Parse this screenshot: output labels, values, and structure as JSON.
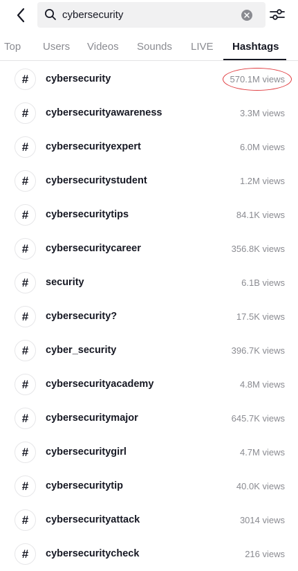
{
  "search": {
    "query": "cybersecurity",
    "back_icon": "chevron-left-icon",
    "search_icon": "magnifier-icon",
    "clear_icon": "clear-x-icon",
    "filter_icon": "sliders-icon"
  },
  "tabs": [
    {
      "label": "Top",
      "active": false
    },
    {
      "label": "Users",
      "active": false
    },
    {
      "label": "Videos",
      "active": false
    },
    {
      "label": "Sounds",
      "active": false
    },
    {
      "label": "LIVE",
      "active": false
    },
    {
      "label": "Hashtags",
      "active": true
    }
  ],
  "hashtag_symbol": "#",
  "hashtags": [
    {
      "name": "cybersecurity",
      "views": "570.1M views",
      "highlighted": true
    },
    {
      "name": "cybersecurityawareness",
      "views": "3.3M views"
    },
    {
      "name": "cybersecurityexpert",
      "views": "6.0M views"
    },
    {
      "name": "cybersecuritystudent",
      "views": "1.2M views"
    },
    {
      "name": "cybersecuritytips",
      "views": "84.1K views"
    },
    {
      "name": "cybersecuritycareer",
      "views": "356.8K views"
    },
    {
      "name": "security",
      "views": "6.1B views"
    },
    {
      "name": "cybersecurity?",
      "views": "17.5K views"
    },
    {
      "name": "cyber_security",
      "views": "396.7K views"
    },
    {
      "name": "cybersecurityacademy",
      "views": "4.8M views"
    },
    {
      "name": "cybersecuritymajor",
      "views": "645.7K views"
    },
    {
      "name": "cybersecuritygirl",
      "views": "4.7M views"
    },
    {
      "name": "cybersecuritytip",
      "views": "40.0K views"
    },
    {
      "name": "cybersecurityattack",
      "views": "3014 views"
    },
    {
      "name": "cybersecuritycheck",
      "views": "216 views"
    }
  ],
  "colors": {
    "highlight_oval": "#e03a3e",
    "text_primary": "#161823",
    "text_secondary": "#8a8b91"
  }
}
